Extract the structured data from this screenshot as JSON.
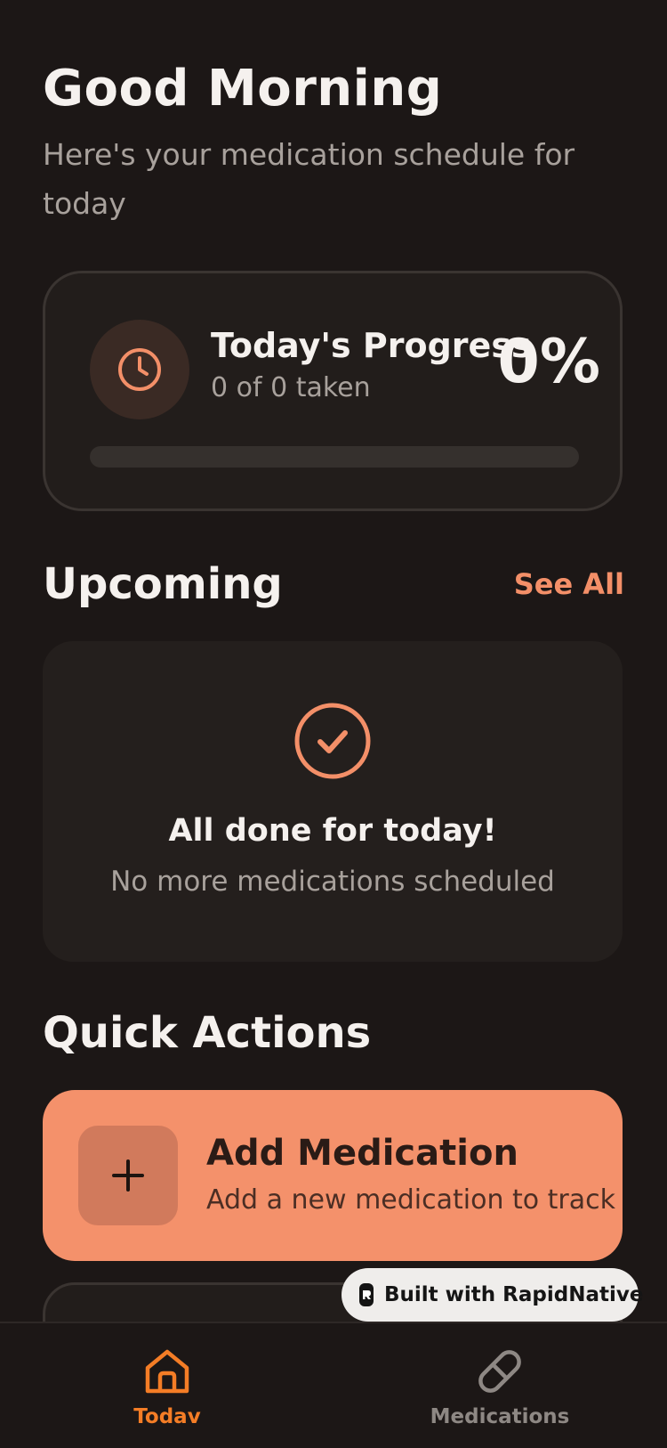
{
  "header": {
    "greeting": "Good Morning",
    "subtitle": "Here's your medication schedule for today"
  },
  "progress": {
    "icon": "clock-icon",
    "title": "Today's Progress",
    "count_text": "0 of 0 taken",
    "percent_text": "0%",
    "percent_value": 0
  },
  "upcoming": {
    "title": "Upcoming",
    "see_all": "See All",
    "empty_icon": "check-circle-icon",
    "empty_title": "All done for today!",
    "empty_subtitle": "No more medications scheduled"
  },
  "quick_actions": {
    "title": "Quick Actions",
    "add": {
      "icon": "plus-icon",
      "title": "Add Medication",
      "subtitle": "Add a new medication to track"
    }
  },
  "badge": {
    "text": "Built with RapidNative"
  },
  "nav": {
    "items": [
      {
        "label": "Todav",
        "icon": "home-icon",
        "active": true
      },
      {
        "label": "Medications",
        "icon": "pill-icon",
        "active": false
      }
    ]
  },
  "colors": {
    "background": "#1c1716",
    "accent": "#f38f68",
    "nav_active": "#f47d26",
    "nav_inactive": "#8e8884"
  }
}
